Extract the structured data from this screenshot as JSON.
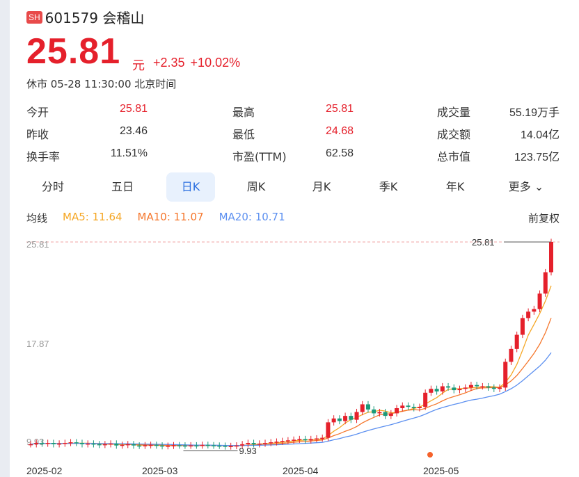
{
  "header": {
    "exchange_badge": "SH",
    "title": "601579 会稽山",
    "price": "25.81",
    "unit": "元",
    "change": "+2.35",
    "change_pct": "+10.02%",
    "timestamp": "休市 05-28 11:30:00 北京时间"
  },
  "stats": [
    {
      "label": "今开",
      "value": "25.81",
      "color": "#e5202b"
    },
    {
      "label": "昨收",
      "value": "23.46",
      "color": "#333333"
    },
    {
      "label": "换手率",
      "value": "11.51%",
      "color": "#333333"
    },
    {
      "label": "最高",
      "value": "25.81",
      "color": "#e5202b"
    },
    {
      "label": "最低",
      "value": "24.68",
      "color": "#e5202b"
    },
    {
      "label": "市盈(TTM)",
      "value": "62.58",
      "color": "#333333"
    },
    {
      "label": "成交量",
      "value": "55.19万手",
      "color": "#333333"
    },
    {
      "label": "成交额",
      "value": "14.04亿",
      "color": "#333333"
    },
    {
      "label": "总市值",
      "value": "123.75亿",
      "color": "#333333"
    }
  ],
  "tabs": [
    "分时",
    "五日",
    "日K",
    "周K",
    "月K",
    "季K",
    "年K",
    "更多"
  ],
  "active_tab": "日K",
  "ma_bar": {
    "label": "均线",
    "ma5": "MA5: 11.64",
    "ma10": "MA10: 11.07",
    "ma20": "MA20: 10.71",
    "adjust": "前复权"
  },
  "colors": {
    "up": "#e5202b",
    "down": "#1a9a7a",
    "ma5": "#f5a623",
    "ma10": "#f5762b",
    "ma20": "#5b8ff0",
    "accent": "#2b6fe0"
  },
  "chart_data": {
    "type": "candlestick",
    "y_ticks": [
      "25.81",
      "17.87",
      "9.93"
    ],
    "ylim": [
      9.93,
      25.81
    ],
    "x_ticks": [
      "2025-02",
      "2025-03",
      "2025-04",
      "2025-05"
    ],
    "annotations": {
      "max": "25.81",
      "min": "9.93"
    },
    "closes": [
      10.1,
      10.2,
      10.15,
      10.2,
      10.1,
      10.15,
      10.2,
      10.25,
      10.2,
      10.1,
      10.15,
      10.1,
      10.05,
      10.1,
      10.15,
      10.0,
      10.05,
      10.1,
      10.0,
      9.98,
      10.02,
      10.05,
      10.0,
      9.95,
      9.98,
      10.02,
      10.0,
      9.99,
      10.01,
      10.0,
      10.05,
      10.02,
      9.99,
      9.98,
      9.93,
      9.96,
      10.0,
      10.1,
      10.2,
      10.1,
      10.15,
      10.2,
      10.25,
      10.3,
      10.35,
      10.4,
      10.45,
      10.5,
      10.4,
      10.5,
      10.55,
      10.6,
      11.8,
      12.1,
      11.9,
      12.3,
      12.0,
      12.6,
      13.2,
      12.8,
      12.5,
      12.6,
      12.3,
      12.5,
      12.9,
      13.1,
      13.0,
      12.9,
      13.0,
      14.1,
      14.4,
      14.2,
      14.6,
      14.5,
      14.3,
      14.4,
      14.5,
      14.7,
      14.6,
      14.6,
      14.5,
      14.4,
      14.5,
      16.5,
      17.5,
      18.6,
      19.9,
      20.4,
      20.6,
      21.8,
      23.46,
      25.81
    ]
  }
}
